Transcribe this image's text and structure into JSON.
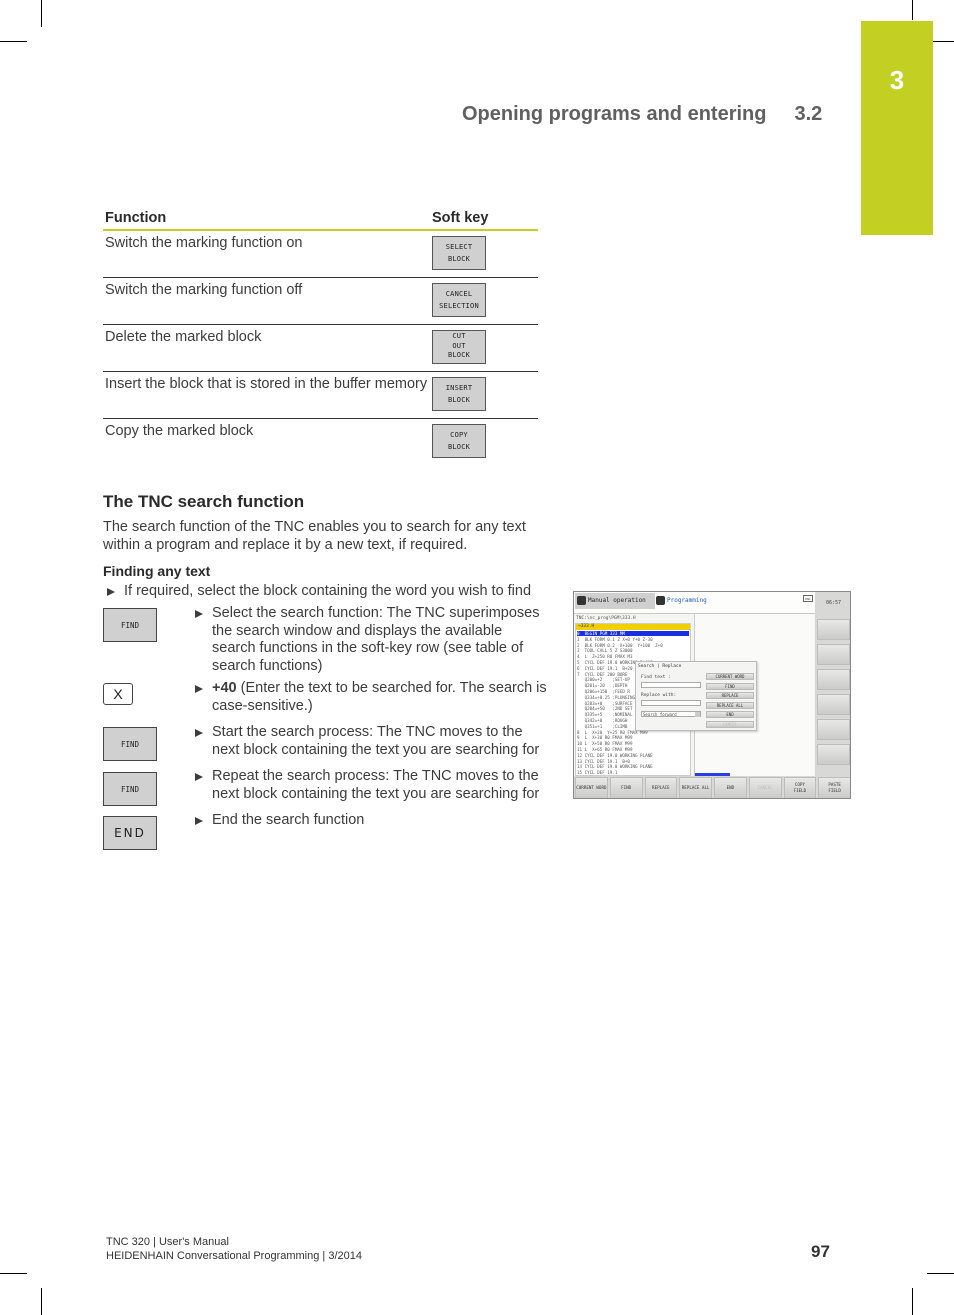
{
  "header": {
    "chapter_number": "3",
    "section_title": "Opening programs and entering",
    "section_number": "3.2",
    "accent_color": "#c3cf23"
  },
  "softkey_table": {
    "headers": [
      "Function",
      "Soft key"
    ],
    "rows": [
      {
        "function": "Switch the marking function on",
        "softkey": [
          "SELECT",
          "BLOCK"
        ]
      },
      {
        "function": "Switch the marking function off",
        "softkey": [
          "CANCEL",
          "SELECTION"
        ]
      },
      {
        "function": "Delete the marked block",
        "softkey": [
          "CUT",
          "OUT",
          "BLOCK"
        ]
      },
      {
        "function": "Insert the block that is stored in the buffer memory",
        "softkey": [
          "INSERT",
          "BLOCK"
        ]
      },
      {
        "function": "Copy the marked block",
        "softkey": [
          "COPY",
          "BLOCK"
        ]
      }
    ]
  },
  "search_section": {
    "title": "The TNC search function",
    "intro": "The search function of the TNC enables you to search for any text within a program and replace it by a new text, if required.",
    "subheading": "Finding any text",
    "pre_step": "If required, select the block containing the word you wish to find",
    "steps": [
      {
        "key": "FIND",
        "bold": "",
        "text": "Select the search function: The TNC superimposes the search window and displays the available search functions in the soft-key row (see table of search functions)"
      },
      {
        "key": "X",
        "bold": "+40",
        "text": " (Enter the text to be searched for. The search is case-sensitive.)"
      },
      {
        "key": "FIND",
        "bold": "",
        "text": "Start the search process: The TNC moves to the next block containing the text you are searching for"
      },
      {
        "key": "FIND",
        "bold": "",
        "text": "Repeat the search process: The TNC moves to the next block containing the text you are searching for"
      },
      {
        "key": "END",
        "bold": "",
        "text": "End the search function"
      }
    ]
  },
  "tnc_screen": {
    "mode_manual": "Manual operation",
    "mode_programming": "Programming",
    "dnc_label": "DNC",
    "clock": "06:57",
    "path": "TNC:\\nc_prog\\PGM\\333.H",
    "filename": "→333.H",
    "program_lines": [
      {
        "text": "0  BEGIN PGM 333 MM",
        "selected": true
      },
      {
        "text": "1  BLK FORM 0.1 Z X+0 Y+0 Z-30"
      },
      {
        "text": "2  BLK FORM 0.2  X+100  Y+100  Z+0"
      },
      {
        "text": "3  TOOL CALL 5 Z S3000"
      },
      {
        "text": "4  L  Z+250 R0 FMAX M3"
      },
      {
        "text": "5  CYCL DEF 19.0 WORKING PLANE"
      },
      {
        "text": "6  CYCL DEF 19.1  B+20"
      },
      {
        "text": "7  CYCL DEF 200 BORE"
      },
      {
        "text": "   Q200=+2    ;SET-UP"
      },
      {
        "text": "   Q201=-20   ;DEPTH"
      },
      {
        "text": "   Q206=+150  ;FEED R"
      },
      {
        "text": "   Q334=+0.25 ;PLUNGING"
      },
      {
        "text": "   Q203=+0    ;SURFACE"
      },
      {
        "text": "   Q204=+50   ;2ND SET"
      },
      {
        "text": "   Q335=+5    ;NOMINAL"
      },
      {
        "text": "   Q342=+0    ;ROUGH"
      },
      {
        "text": "   Q351=+1    ;CLIMB"
      },
      {
        "text": "8  L  X+20  Y+25 R0 FMAX M99"
      },
      {
        "text": "9  L  X+30 R0 FMAX M99"
      },
      {
        "text": "10 L  X+50 R0 FMAX M99"
      },
      {
        "text": "11 L  X+65 R0 FMAX M99"
      },
      {
        "text": "12 CYCL DEF 19.0 WORKING PLANE"
      },
      {
        "text": "13 CYCL DEF 19.1  B+0"
      },
      {
        "text": "14 CYCL DEF 19.0 WORKING PLANE"
      },
      {
        "text": "15 CYCL DEF 19.1"
      }
    ],
    "dialog": {
      "title": "Search | Replace",
      "find_label": "Find text :",
      "find_value": "",
      "replace_label": "Replace with:",
      "replace_value": "",
      "direction": "Search forward",
      "buttons": [
        {
          "label": "CURRENT WORD",
          "disabled": false
        },
        {
          "label": "FIND",
          "disabled": false
        },
        {
          "label": "REPLACE",
          "disabled": false
        },
        {
          "label": "REPLACE ALL",
          "disabled": false
        },
        {
          "label": "END",
          "disabled": false
        },
        {
          "label": "CANCEL",
          "disabled": true
        }
      ]
    },
    "softkeys": [
      {
        "lines": [
          "CURRENT WORD"
        ],
        "disabled": false
      },
      {
        "lines": [
          "FIND"
        ],
        "disabled": false
      },
      {
        "lines": [
          "REPLACE"
        ],
        "disabled": false
      },
      {
        "lines": [
          "REPLACE ALL"
        ],
        "disabled": false
      },
      {
        "lines": [
          "END"
        ],
        "disabled": false
      },
      {
        "lines": [
          "CANCEL"
        ],
        "disabled": true
      },
      {
        "lines": [
          "COPY",
          "FIELD"
        ],
        "disabled": false
      },
      {
        "lines": [
          "PASTE",
          "FIELD"
        ],
        "disabled": false
      }
    ]
  },
  "footer": {
    "line1": "TNC 320 | User's Manual",
    "line2": "HEIDENHAIN Conversational Programming | 3/2014",
    "page_number": "97"
  }
}
